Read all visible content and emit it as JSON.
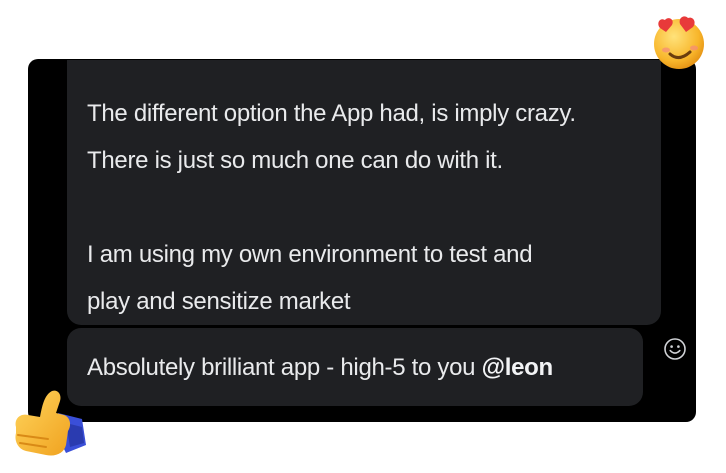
{
  "messages": {
    "main": {
      "paragraph1_line1": "The different option the App had, is imply crazy.",
      "paragraph1_line2": "There is just so much one can do with it.",
      "paragraph2_line1": "I am using my own environment to test and",
      "paragraph2_line2": "play and sensitize market"
    },
    "reply": {
      "text": "Absolutely brilliant app - high-5 to you ",
      "mention": "@leon"
    }
  },
  "icons": {
    "reaction": "smiley-face-icon",
    "sticker_top": "heart-eyes-emoji-icon",
    "sticker_bottom": "thumbs-up-emoji-icon"
  },
  "colors": {
    "panel_bg": "#000000",
    "bubble_bg": "#1f2023",
    "text": "#e9eaec"
  }
}
